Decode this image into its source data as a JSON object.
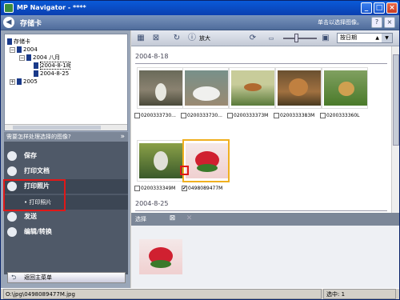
{
  "window": {
    "title": "MP Navigator - ****",
    "min": "_",
    "max": "□",
    "close": "×"
  },
  "header": {
    "title": "存储卡",
    "info": "单击以选择图像。",
    "back_glyph": "◀",
    "help_glyph": "?",
    "close_glyph": "×"
  },
  "tree": {
    "root": "存储卡",
    "year1": "2004",
    "month1": "2004 八月",
    "day1": "2004-8-18",
    "day2": "2004-8-25",
    "year2": "2005"
  },
  "tasks": {
    "header": "需要怎样处理选择的图像?",
    "items": [
      {
        "label": "保存"
      },
      {
        "label": "打印文档"
      },
      {
        "label": "打印照片"
      },
      {
        "label": "发送"
      },
      {
        "label": "编辑/转换"
      }
    ],
    "sub_item": "• 打印照片",
    "back_button": "返回主菜单"
  },
  "toolbar": {
    "enlarge_label": "放大",
    "sort_value": "按日期",
    "sort_arrow": "▲"
  },
  "groups": [
    {
      "date": "2004-8-18",
      "captions": [
        "0200333730...",
        "0200333730...",
        "0200333373M",
        "0200333383M",
        "0200333360L",
        "0200333349M",
        "0498089477M"
      ]
    },
    {
      "date": "2004-8-25"
    }
  ],
  "selected_checkmark": "✔",
  "selection": {
    "label": "选择"
  },
  "status": {
    "path": "O:\\jpg\\0498089477M.jpg",
    "count": "选中: 1"
  }
}
